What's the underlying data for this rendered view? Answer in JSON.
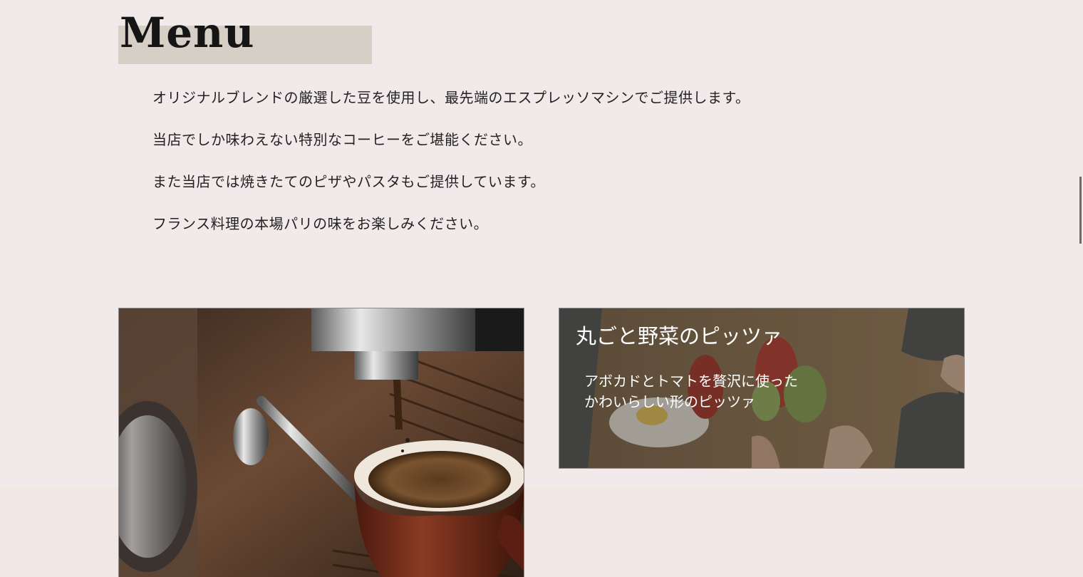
{
  "menu": {
    "title": "Menu"
  },
  "intro": {
    "lines": [
      "オリジナルブレンドの厳選した豆を使用し、最先端のエスプレッソマシンでご提供します。",
      "当店でしか味わえない特別なコーヒーをご堪能ください。",
      "また当店では焼きたてのピザやパスタもご提供しています。",
      "フランス料理の本場パリの味をお楽しみください。"
    ]
  },
  "cards": {
    "coffee": {
      "image": "espresso-machine-coffee-cup-photo"
    },
    "pizza": {
      "image": "avocado-tomato-toast-on-board-photo",
      "title": "丸ごと野菜のピッツァ",
      "desc_line1": "アボカドとトマトを贅沢に使った",
      "desc_line2": "かわいらしい形のピッツァ"
    }
  },
  "colors": {
    "page_bg": "#f2eaea",
    "title_highlight": "#d6cfc6",
    "lower_band": "#f1e8e3"
  }
}
